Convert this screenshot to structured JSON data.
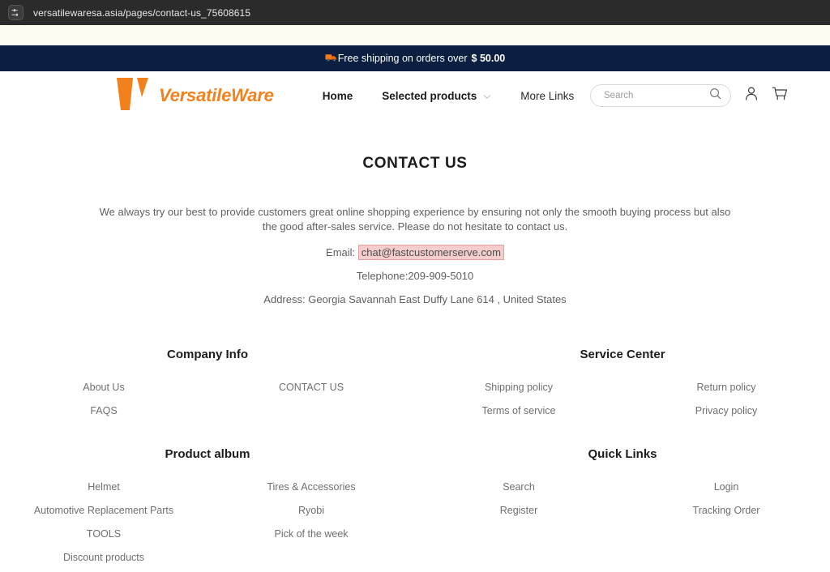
{
  "browser": {
    "site_info_icon": "tune-sliders-icon",
    "url": "versatilewaresa.asia/pages/contact-us_75608615"
  },
  "promo": {
    "icon": "delivery-truck-icon",
    "text": "Free shipping on orders over",
    "amount": "$ 50.00"
  },
  "header": {
    "brand": {
      "logo_icon": "versatileware-v-mark",
      "name": "VersatileWare",
      "color": "#f2811d"
    },
    "nav": [
      {
        "label": "Home",
        "bold": true,
        "has_caret": false
      },
      {
        "label": "Selected products",
        "bold": true,
        "has_caret": true
      },
      {
        "label": "More Links",
        "bold": false,
        "has_caret": false
      }
    ],
    "search": {
      "placeholder": "Search",
      "value": "",
      "icon": "search-icon"
    },
    "account_icon": "user-account-icon",
    "cart_icon": "shopping-cart-icon"
  },
  "page": {
    "title": "CONTACT US",
    "intro_line1": "We always try our best to provide customers great online shopping experience by ensuring not only the smooth buying process but also the good after-sales service.",
    "intro_line2": "Please do not hesitate to contact us.",
    "email_label": "Email:",
    "email_value": "chat@fastcustomerserve.com",
    "telephone": "Telephone:209-909-5010",
    "address": "Address: Georgia Savannah East Duffy Lane 614 , United States"
  },
  "footer": {
    "sections": [
      {
        "heading": "Company Info",
        "links": [
          "About Us",
          "CONTACT US",
          "FAQS"
        ]
      },
      {
        "heading": "Service Center",
        "links": [
          "Shipping policy",
          "Return policy",
          "Terms of service",
          "Privacy policy"
        ]
      },
      {
        "heading": "Product album",
        "links": [
          "Helmet",
          "Tires & Accessories",
          "Automotive Replacement Parts",
          "Ryobi",
          "TOOLS",
          "Pick of the week",
          "Discount products"
        ]
      },
      {
        "heading": "Quick Links",
        "links": [
          "Search",
          "Login",
          "Register",
          "Tracking Order"
        ]
      }
    ]
  }
}
